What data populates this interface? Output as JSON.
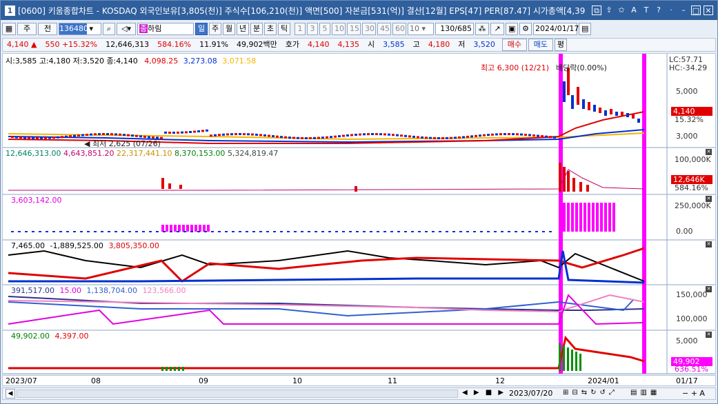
{
  "title": {
    "text": "[0600] 키움종합차트 - KOSDAQ 외국인보유[3,805(천)] 주식수[106,210(천)] 액면[500] 자본금[531(억)] 결산[12월] EPS[47] PER[87.47] 시가총액[4,39",
    "window_number": "1"
  },
  "toolbar": {
    "type1": "주",
    "type2": "전",
    "code": "136480",
    "stock_name": "하림",
    "stock_badge": "종",
    "periods": [
      "일",
      "주",
      "월",
      "년",
      "분",
      "초",
      "틱"
    ],
    "numbers": [
      "1",
      "3",
      "5",
      "10",
      "15",
      "30",
      "45",
      "60"
    ],
    "count_value": "10",
    "page_counter": "130/685",
    "date": "2024/01/17"
  },
  "quote": {
    "price": "4,140",
    "change": "550",
    "change_rate": "+15.32%",
    "volume": "12,646,313",
    "volume_rate": "584.16%",
    "turnover": "11.91%",
    "amount": "49,902백만",
    "hoga_label": "호가",
    "ask": "4,140",
    "bid": "4,135",
    "open_label": "시",
    "open": "3,585",
    "high_label": "고",
    "high": "4,180",
    "low_label": "저",
    "low": "3,520",
    "buy_label": "매수",
    "sell_label": "매도",
    "eval_label": "평"
  },
  "panels": {
    "price": {
      "legend_ohlc": "시:3,585 고:4,180 저:3,520 종:4,140",
      "ma1": "4,098.25",
      "ma2": "3,273.08",
      "ma3": "3,071.58",
      "high_note": "최고 6,300 (12/21)",
      "low_note": "최저 2,625 (07/26)",
      "limit_note": "배당락(0.00%)",
      "lc": "LC:57.71",
      "hc": "HC:-34.29",
      "ticks": [
        "5,000",
        "3,000"
      ],
      "price_tag": "4,140",
      "rate_tag": "15.32%"
    },
    "volume": {
      "legend": [
        "12,646,313.00",
        "4,643,851.20",
        "22,317,441.10",
        "8,370,153.00",
        "5,324,819.47"
      ],
      "ticks": [
        "100,000K"
      ],
      "vol_tag": "12,646K",
      "rate_tag": "584.16%"
    },
    "p3": {
      "legend": "3,603,142.00",
      "ticks": [
        "250,000K",
        "0.00"
      ]
    },
    "p4": {
      "legend": [
        "7,465.00",
        "-1,889,525.00",
        "3,805,350.00"
      ]
    },
    "p5": {
      "legend": [
        "391,517.00",
        "15.00",
        "1,138,704.00",
        "123,566.00"
      ],
      "ticks": [
        "150,000",
        "100,000"
      ]
    },
    "p6": {
      "legend": [
        "49,902.00",
        "4,397.00"
      ],
      "ticks": [
        "5,000"
      ],
      "tag1": "49,902",
      "tag2": "636.51%"
    }
  },
  "xaxis": [
    "2023/07",
    "08",
    "09",
    "10",
    "11",
    "12",
    "2024/01",
    "01/17"
  ],
  "scroll": {
    "date_left": "2023/07/20",
    "date_right": "2024/01/17"
  },
  "colors": {
    "up": "#e00000",
    "down": "#0030d0",
    "magenta": "#ff00ff",
    "gold": "#f5b400",
    "green": "#009000"
  }
}
